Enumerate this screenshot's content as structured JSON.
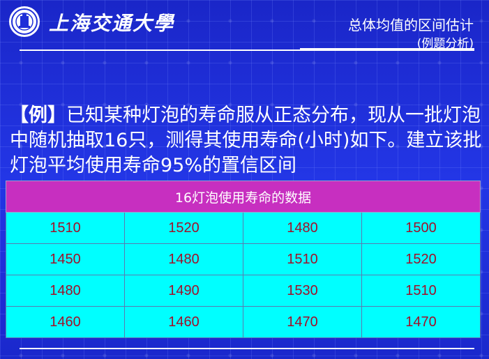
{
  "header": {
    "university_name": "上海交通大學",
    "slide_title": "总体均值的区间估计",
    "slide_subtitle": "(例题分析)",
    "logo_icon": "university-seal-icon"
  },
  "problem": {
    "tag": "【例】",
    "text": "已知某种灯泡的寿命服从正态分布，现从一批灯泡中随机抽取16只，测得其使用寿命(小时)如下。建立该批灯泡平均使用寿命95%的置信区间"
  },
  "table": {
    "caption": "16灯泡使用寿命的数据",
    "rows": [
      [
        "1510",
        "1520",
        "1480",
        "1500"
      ],
      [
        "1450",
        "1480",
        "1510",
        "1520"
      ],
      [
        "1480",
        "1490",
        "1530",
        "1510"
      ],
      [
        "1460",
        "1460",
        "1470",
        "1470"
      ]
    ]
  },
  "colors": {
    "background": "#1f2fd8",
    "header_bar": "#c72fc0",
    "cell_bg": "#00ffff",
    "cell_text": "#a0112a"
  }
}
